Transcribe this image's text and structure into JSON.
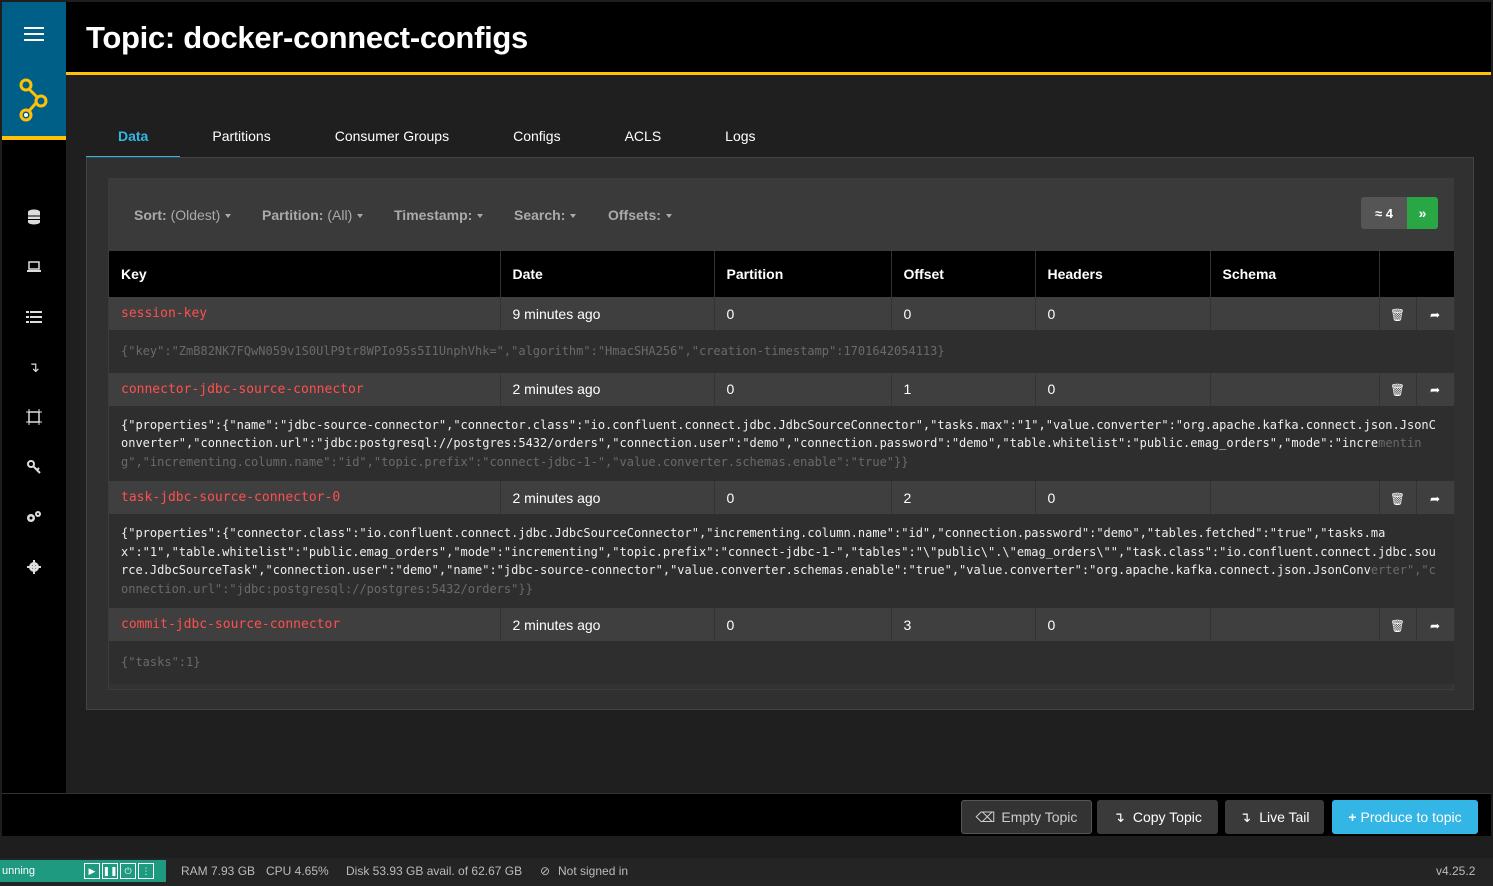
{
  "page": {
    "title": "Topic: docker-connect-configs"
  },
  "sidebar": {
    "icons": [
      "menu-icon",
      "logo-icon",
      "database-icon",
      "laptop-icon",
      "list-icon",
      "arrow-icon",
      "frame-icon",
      "key-icon",
      "gears-icon",
      "gear-icon"
    ]
  },
  "tabs": [
    {
      "label": "Data",
      "active": true
    },
    {
      "label": "Partitions"
    },
    {
      "label": "Consumer Groups"
    },
    {
      "label": "Configs"
    },
    {
      "label": "ACLS"
    },
    {
      "label": "Logs"
    }
  ],
  "toolbar": {
    "sort_label": "Sort:",
    "sort_value": "(Oldest)",
    "partition_label": "Partition:",
    "partition_value": "(All)",
    "timestamp_label": "Timestamp:",
    "search_label": "Search:",
    "offsets_label": "Offsets:",
    "count": "≈ 4",
    "next": "»"
  },
  "table": {
    "headers": [
      "Key",
      "Date",
      "Partition",
      "Offset",
      "Headers",
      "Schema"
    ],
    "rows": [
      {
        "key": "session-key",
        "date": "9 minutes ago",
        "partition": "0",
        "offset": "0",
        "headers": "0",
        "schema": "",
        "value_visible": "{\"key\":\"ZmB82NK7FQwN059v1S0UlP9tr8WPIo95s5I1UnphVhk=\",\"algorithm\":\"HmacSHA256\",\"creation-timestamp\":1701642054113}",
        "value_faded": ""
      },
      {
        "key": "connector-jdbc-source-connector",
        "date": "2 minutes ago",
        "partition": "0",
        "offset": "1",
        "headers": "0",
        "schema": "",
        "value_visible": "{\"properties\":{\"name\":\"jdbc-source-connector\",\"connector.class\":\"io.confluent.connect.jdbc.JdbcSourceConnector\",\"tasks.max\":\"1\",\"value.converter\":\"org.apache.kafka.connect.json.JsonConverter\",\"connection.url\":\"jdbc:postgresql://postgres:5432/orders\",\"connection.user\":\"demo\",\"connection.password\":\"demo\",\"table.whitelist\":\"public.emag_orders\",\"mode\":\"incre",
        "value_faded": "menting\",\"incrementing.column.name\":\"id\",\"topic.prefix\":\"connect-jdbc-1-\",\"value.converter.schemas.enable\":\"true\"}}"
      },
      {
        "key": "task-jdbc-source-connector-0",
        "date": "2 minutes ago",
        "partition": "0",
        "offset": "2",
        "headers": "0",
        "schema": "",
        "value_visible": "{\"properties\":{\"connector.class\":\"io.confluent.connect.jdbc.JdbcSourceConnector\",\"incrementing.column.name\":\"id\",\"connection.password\":\"demo\",\"tables.fetched\":\"true\",\"tasks.max\":\"1\",\"table.whitelist\":\"public.emag_orders\",\"mode\":\"incrementing\",\"topic.prefix\":\"connect-jdbc-1-\",\"tables\":\"\\\"public\\\".\\\"emag_orders\\\"\",\"task.class\":\"io.confluent.connect.jdbc.source.JdbcSourceTask\",\"connection.user\":\"demo\",\"name\":\"jdbc-source-connector\",\"value.converter.schemas.enable\":\"true\",\"value.converter\":\"org.apache.kafka.connect.json.JsonConv",
        "value_faded": "erter\",\"connection.url\":\"jdbc:postgresql://postgres:5432/orders\"}}"
      },
      {
        "key": "commit-jdbc-source-connector",
        "date": "2 minutes ago",
        "partition": "0",
        "offset": "3",
        "headers": "0",
        "schema": "",
        "value_visible": "{\"tasks\":1}",
        "value_faded": ""
      }
    ]
  },
  "bottom_actions": {
    "empty": "Empty Topic",
    "copy": "Copy Topic",
    "live_tail": "Live Tail",
    "produce": "Produce to topic"
  },
  "statusbar": {
    "running": "unning",
    "ram": "RAM 7.93 GB",
    "cpu": "CPU 4.65%",
    "disk": "Disk 53.93 GB avail. of 62.67 GB",
    "signin": "Not signed in",
    "version": "v4.25.2"
  },
  "colors": {
    "accent": "#33b5e5",
    "brand_yellow": "#ffc107",
    "sidebar_blue": "#005f87",
    "key_red": "#ff4f4f",
    "success": "#29a745"
  }
}
